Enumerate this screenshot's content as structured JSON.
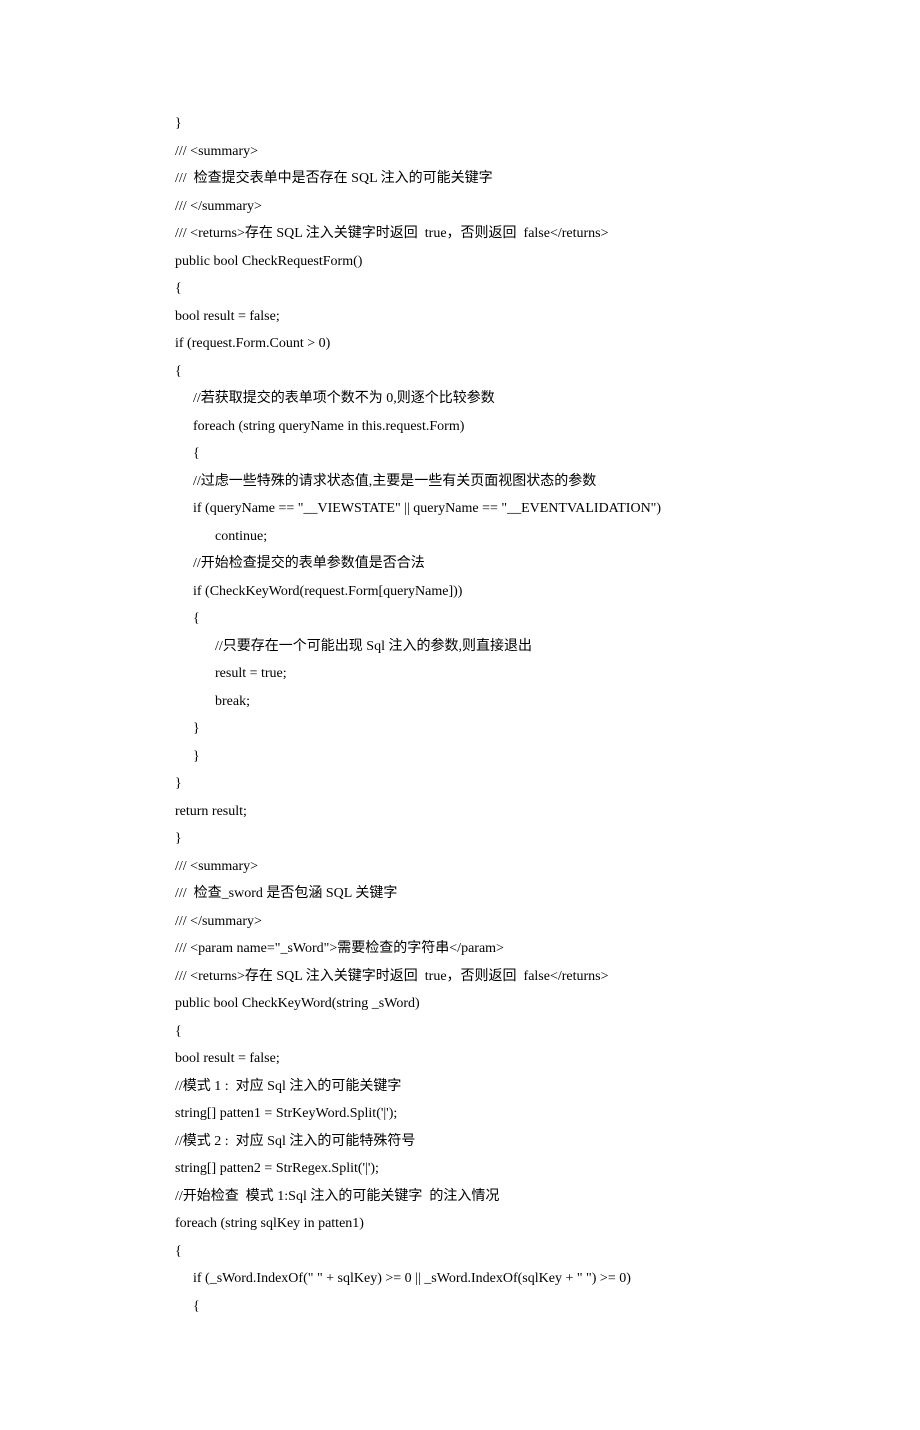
{
  "lines": [
    {
      "t": "}",
      "cls": ""
    },
    {
      "t": "/// <summary>",
      "cls": ""
    },
    {
      "t": "///  检查提交表单中是否存在 SQL 注入的可能关键字",
      "cls": ""
    },
    {
      "t": "/// </summary>",
      "cls": ""
    },
    {
      "t": "/// <returns>存在 SQL 注入关键字时返回  true，否则返回  false</returns>",
      "cls": ""
    },
    {
      "t": "public bool CheckRequestForm()",
      "cls": ""
    },
    {
      "t": "{",
      "cls": ""
    },
    {
      "t": "bool result = false;",
      "cls": ""
    },
    {
      "t": "if (request.Form.Count > 0)",
      "cls": ""
    },
    {
      "t": "{",
      "cls": ""
    },
    {
      "t": "//若获取提交的表单项个数不为 0,则逐个比较参数",
      "cls": "indent1"
    },
    {
      "t": "foreach (string queryName in this.request.Form)",
      "cls": "indent1"
    },
    {
      "t": "{",
      "cls": "indent1"
    },
    {
      "t": "//过虑一些特殊的请求状态值,主要是一些有关页面视图状态的参数",
      "cls": "indent1"
    },
    {
      "t": "if (queryName == \"__VIEWSTATE\" || queryName == \"__EVENTVALIDATION\")",
      "cls": "indent1"
    },
    {
      "t": "continue;",
      "cls": "indent2"
    },
    {
      "t": "//开始检查提交的表单参数值是否合法",
      "cls": "indent1"
    },
    {
      "t": "if (CheckKeyWord(request.Form[queryName]))",
      "cls": "indent1"
    },
    {
      "t": "{",
      "cls": "indent1"
    },
    {
      "t": "//只要存在一个可能出现 Sql 注入的参数,则直接退出",
      "cls": "indent2"
    },
    {
      "t": "result = true;",
      "cls": "indent2"
    },
    {
      "t": "break;",
      "cls": "indent2"
    },
    {
      "t": "}",
      "cls": "indent1"
    },
    {
      "t": "}",
      "cls": "indent1"
    },
    {
      "t": "}",
      "cls": ""
    },
    {
      "t": "return result;",
      "cls": ""
    },
    {
      "t": "}",
      "cls": ""
    },
    {
      "t": "/// <summary>",
      "cls": ""
    },
    {
      "t": "///  检查_sword 是否包涵 SQL 关键字",
      "cls": ""
    },
    {
      "t": "/// </summary>",
      "cls": ""
    },
    {
      "t": "/// <param name=\"_sWord\">需要检查的字符串</param>",
      "cls": ""
    },
    {
      "t": "/// <returns>存在 SQL 注入关键字时返回  true，否则返回  false</returns>",
      "cls": ""
    },
    {
      "t": "public bool CheckKeyWord(string _sWord)",
      "cls": ""
    },
    {
      "t": "{",
      "cls": ""
    },
    {
      "t": "bool result = false;",
      "cls": ""
    },
    {
      "t": "//模式 1 :  对应 Sql 注入的可能关键字",
      "cls": ""
    },
    {
      "t": "string[] patten1 = StrKeyWord.Split('|');",
      "cls": ""
    },
    {
      "t": "//模式 2 :  对应 Sql 注入的可能特殊符号",
      "cls": ""
    },
    {
      "t": "string[] patten2 = StrRegex.Split('|');",
      "cls": ""
    },
    {
      "t": "//开始检查  模式 1:Sql 注入的可能关键字  的注入情况",
      "cls": ""
    },
    {
      "t": "foreach (string sqlKey in patten1)",
      "cls": ""
    },
    {
      "t": "{",
      "cls": ""
    },
    {
      "t": "if (_sWord.IndexOf(\" \" + sqlKey) >= 0 || _sWord.IndexOf(sqlKey + \" \") >= 0)",
      "cls": "indent1"
    },
    {
      "t": "{",
      "cls": "indent1"
    }
  ]
}
